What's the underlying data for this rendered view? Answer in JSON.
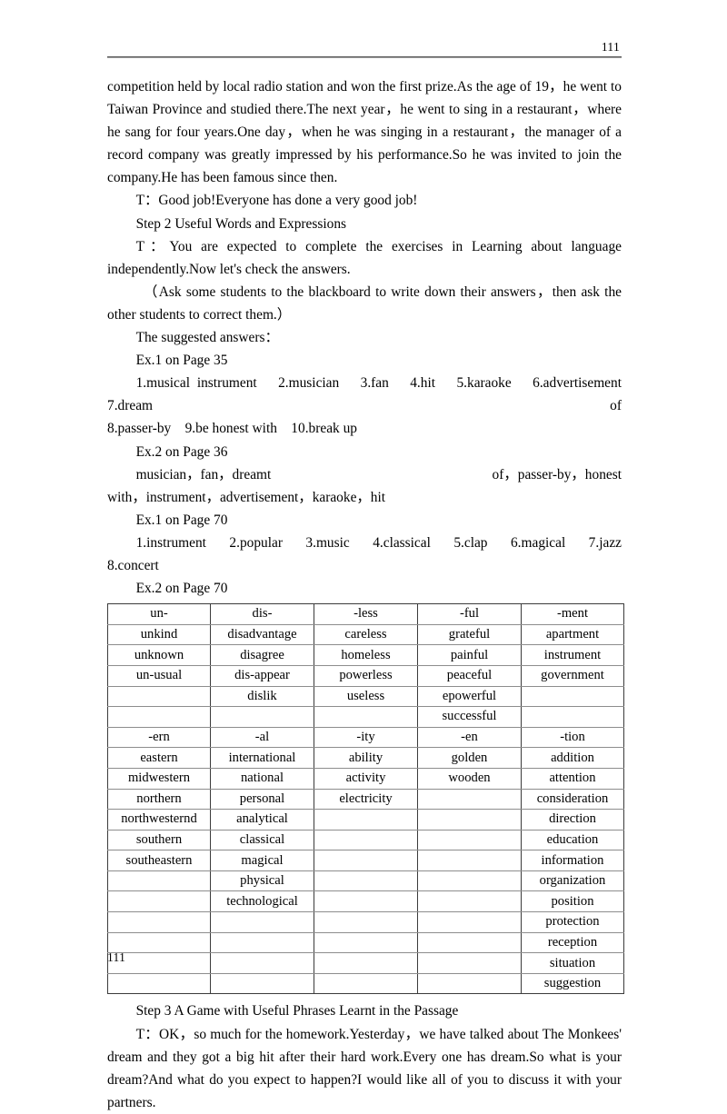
{
  "header": {
    "page_number": "111"
  },
  "footer": {
    "page_number": "111"
  },
  "body": {
    "para_continued": "competition held by local radio station and won the first prize.As the age of 19，he went to Taiwan Province and studied there.The next year，he went to sing in a restaurant，where he sang for four years.One day，when he was singing in a restaurant，the manager of a record company was greatly impressed by his performance.So he was invited to join the company.He has been famous since then.",
    "line_good_job": "T：Good job!Everyone has done a very good job!",
    "line_step2": "Step 2 Useful Words and Expressions",
    "para_expected": "T：You are expected to complete the exercises in Learning about language independently.Now let's check the answers.",
    "para_ask": "（Ask some students to the blackboard to write down their answers，then ask the other students to correct them.）",
    "line_suggested": "The suggested answers：",
    "line_ex1_p35": "Ex.1 on Page 35",
    "line_ex1_p35_answers_a": "1.musical instrument　2.musician　3.fan　4.hit　5.karaoke　6.advertisement 7.dream of",
    "line_ex1_p35_answers_b": "8.passer-by　9.be honest with　10.break up",
    "line_ex2_p36": "Ex.2 on Page 36",
    "line_ex2_p36_answers_a_left": "musician，fan，dreamt",
    "line_ex2_p36_answers_a_right": "of，passer-by，honest",
    "line_ex2_p36_answers_b": "with，instrument，advertisement，karaoke，hit",
    "line_ex1_p70": "Ex.1 on Page 70",
    "line_ex1_p70_answers": "1.instrument　2.popular　3.music　4.classical　5.clap　6.magical　7.jazz　8.concert",
    "line_ex2_p70": "Ex.2 on Page 70",
    "line_step3": "Step 3 A Game with Useful Phrases Learnt in the Passage",
    "para_ok": "T：OK，so much for the homework.Yesterday，we have talked about The Monkees' dream and they got a big hit after their hard work.Every one has dream.So what is your dream?And what do you expect to happen?I would like all of you to discuss it with your partners."
  },
  "word_table": {
    "rows": [
      [
        "un-",
        "dis-",
        "-less",
        "-ful",
        "-ment"
      ],
      [
        "unkind",
        "disadvantage",
        "careless",
        "grateful",
        "apartment"
      ],
      [
        "unknown",
        "disagree",
        "homeless",
        "painful",
        "instrument"
      ],
      [
        "un-usual",
        "dis-appear",
        "powerless",
        "peaceful",
        "government"
      ],
      [
        "",
        "dislik",
        "useless",
        "epowerful",
        ""
      ],
      [
        "",
        "",
        "",
        "successful",
        ""
      ],
      [
        "-ern",
        "-al",
        "-ity",
        "-en",
        "-tion"
      ],
      [
        "eastern",
        "international",
        "ability",
        "golden",
        "addition"
      ],
      [
        "midwestern",
        "national",
        "activity",
        "wooden",
        "attention"
      ],
      [
        "northern",
        "personal",
        "electricity",
        "",
        "consideration"
      ],
      [
        "northwesternd",
        "analytical",
        "",
        "",
        "direction"
      ],
      [
        "southern",
        "classical",
        "",
        "",
        "education"
      ],
      [
        "southeastern",
        "magical",
        "",
        "",
        "information"
      ],
      [
        "",
        "physical",
        "",
        "",
        "organization"
      ],
      [
        "",
        "technological",
        "",
        "",
        "position"
      ],
      [
        "",
        "",
        "",
        "",
        "protection"
      ],
      [
        "",
        "",
        "",
        "",
        "reception"
      ],
      [
        "",
        "",
        "",
        "",
        "situation"
      ],
      [
        "",
        "",
        "",
        "",
        "suggestion"
      ]
    ]
  }
}
